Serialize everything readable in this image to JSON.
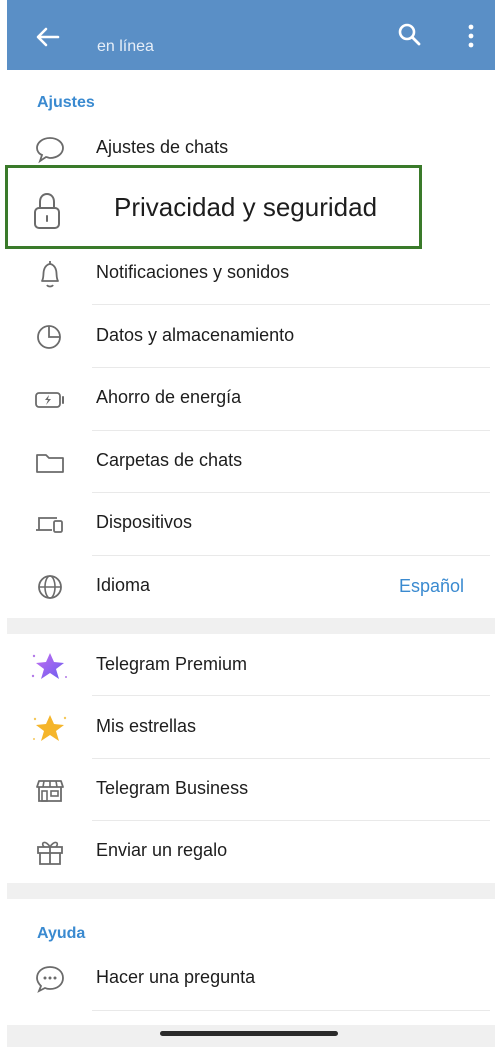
{
  "header": {
    "status": "en línea"
  },
  "sections": {
    "ajustes_title": "Ajustes",
    "ayuda_title": "Ayuda"
  },
  "settings": [
    {
      "label": "Ajustes de chats",
      "icon": "chat-bubble-icon"
    },
    {
      "label": "Privacidad y seguridad",
      "icon": "lock-icon"
    },
    {
      "label": "Notificaciones y sonidos",
      "icon": "bell-icon"
    },
    {
      "label": "Datos y almacenamiento",
      "icon": "pie-chart-icon"
    },
    {
      "label": "Ahorro de energía",
      "icon": "battery-icon"
    },
    {
      "label": "Carpetas de chats",
      "icon": "folder-icon"
    },
    {
      "label": "Dispositivos",
      "icon": "devices-icon"
    },
    {
      "label": "Idioma",
      "icon": "globe-icon",
      "value": "Español"
    }
  ],
  "extras": [
    {
      "label": "Telegram Premium",
      "icon": "premium-star-icon"
    },
    {
      "label": "Mis estrellas",
      "icon": "gold-star-icon"
    },
    {
      "label": "Telegram Business",
      "icon": "store-icon"
    },
    {
      "label": "Enviar un regalo",
      "icon": "gift-icon"
    }
  ],
  "help": [
    {
      "label": "Hacer una pregunta",
      "icon": "chat-dots-icon"
    }
  ],
  "colors": {
    "header": "#5a8fc6",
    "accent": "#3a8ad0",
    "highlight_border": "#3a7a2a"
  }
}
